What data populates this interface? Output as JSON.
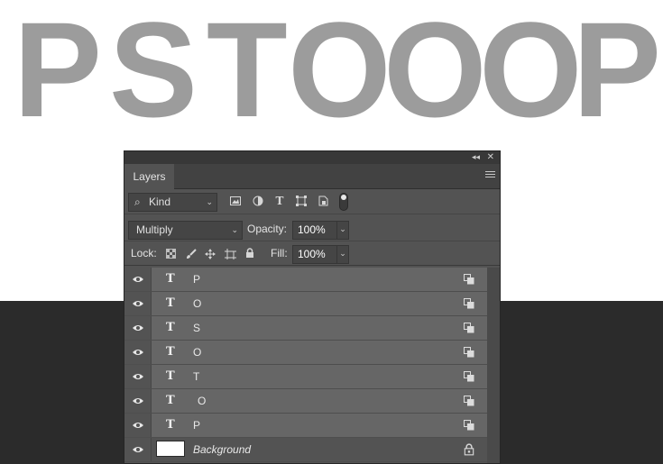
{
  "canvas": {
    "letters": [
      "P",
      "S",
      "T",
      "O",
      "O",
      "O",
      "P"
    ],
    "text_color": "#9c9c9c",
    "bottom_bg": "#2b2b2b"
  },
  "panel": {
    "topbar": {
      "collapse_glyph": "◂◂",
      "close_glyph": "✕"
    },
    "tab_label": "Layers",
    "filter": {
      "kind_label": "Kind",
      "search_glyph": "⌕",
      "chevron": "⌄"
    },
    "blend": {
      "mode": "Multiply",
      "opacity_label": "Opacity:",
      "opacity_value": "100%"
    },
    "lock": {
      "label": "Lock:",
      "fill_label": "Fill:",
      "fill_value": "100%"
    },
    "layers": [
      {
        "name": "P",
        "type_glyph": "T"
      },
      {
        "name": "O",
        "type_glyph": "T"
      },
      {
        "name": "S",
        "type_glyph": "T"
      },
      {
        "name": "O",
        "type_glyph": "T"
      },
      {
        "name": "T",
        "type_glyph": "T"
      },
      {
        "name": "O",
        "type_glyph": "T"
      },
      {
        "name": "P",
        "type_glyph": "T"
      }
    ],
    "background_layer": {
      "name": "Background"
    }
  }
}
